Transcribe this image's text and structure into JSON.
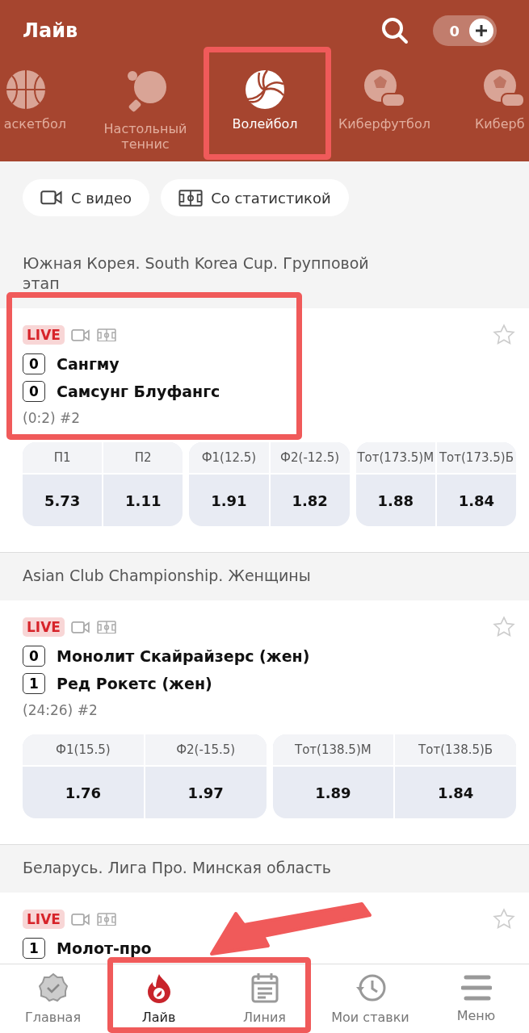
{
  "header": {
    "title": "Лайв",
    "balance": "0"
  },
  "sport_tabs": [
    {
      "label": "аскетбол",
      "kind": "basketball",
      "selected": false
    },
    {
      "label": "Настольный теннис",
      "kind": "table-tennis",
      "selected": false
    },
    {
      "label": "Волейбол",
      "kind": "volleyball",
      "selected": true
    },
    {
      "label": "Киберфутбол",
      "kind": "cyber",
      "selected": false
    },
    {
      "label": "Киберб",
      "kind": "cyber",
      "selected": false
    }
  ],
  "filters": [
    {
      "label": "С видео",
      "kind": "video"
    },
    {
      "label": "Со статистикой",
      "kind": "stats"
    }
  ],
  "sections": [
    {
      "title": "Южная Корея. South Korea Cup. Групповой этап",
      "matches": [
        {
          "badge": "LIVE",
          "teams": [
            {
              "score": "0",
              "name": "Сангму"
            },
            {
              "score": "0",
              "name": "Самсунг Блуфангс"
            }
          ],
          "info": "(0:2) #2",
          "odds_groups": [
            [
              {
                "label": "П1",
                "value": "5.73"
              },
              {
                "label": "П2",
                "value": "1.11"
              }
            ],
            [
              {
                "label": "Ф1(12.5)",
                "value": "1.91"
              },
              {
                "label": "Ф2(-12.5)",
                "value": "1.82"
              }
            ],
            [
              {
                "label": "Тот(173.5)М",
                "value": "1.88"
              },
              {
                "label": "Тот(173.5)Б",
                "value": "1.84"
              }
            ]
          ]
        }
      ]
    },
    {
      "title": "Asian Club Championship. Женщины",
      "matches": [
        {
          "badge": "LIVE",
          "teams": [
            {
              "score": "0",
              "name": "Монолит Скайрайзерс (жен)"
            },
            {
              "score": "1",
              "name": "Ред Рокетс (жен)"
            }
          ],
          "info": "(24:26) #2",
          "odds_groups": [
            [
              {
                "label": "Ф1(15.5)",
                "value": "1.76"
              },
              {
                "label": "Ф2(-15.5)",
                "value": "1.97"
              }
            ],
            [
              {
                "label": "Тот(138.5)М",
                "value": "1.89"
              },
              {
                "label": "Тот(138.5)Б",
                "value": "1.84"
              }
            ]
          ]
        }
      ]
    },
    {
      "title": "Беларусь. Лига Про. Минская область",
      "matches": [
        {
          "badge": "LIVE",
          "teams": [
            {
              "score": "1",
              "name": "Молот-про"
            }
          ]
        }
      ]
    }
  ],
  "bottom_nav": [
    {
      "label": "Главная",
      "kind": "home",
      "selected": false
    },
    {
      "label": "Лайв",
      "kind": "live",
      "selected": true
    },
    {
      "label": "Линия",
      "kind": "line",
      "selected": false
    },
    {
      "label": "Мои ставки",
      "kind": "bets",
      "selected": false
    },
    {
      "label": "Меню",
      "kind": "menu",
      "selected": false
    }
  ]
}
